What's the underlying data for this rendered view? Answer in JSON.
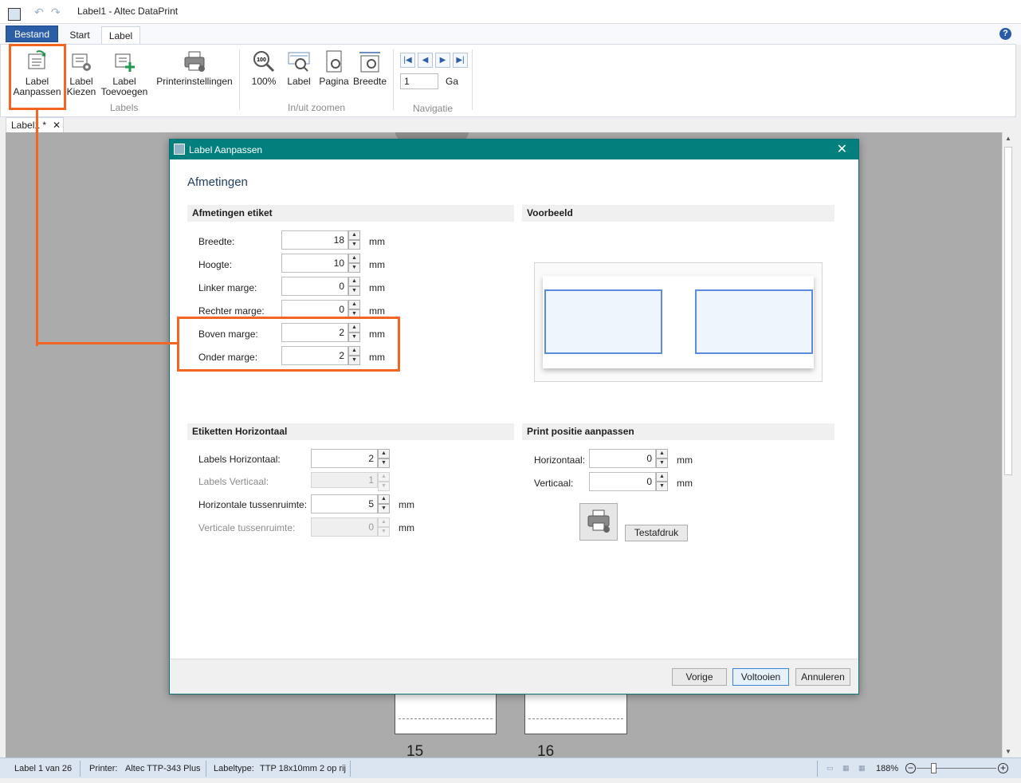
{
  "window": {
    "title": "Label1 - Altec DataPrint"
  },
  "ribbon_tabs": {
    "file": "Bestand",
    "start": "Start",
    "label": "Label"
  },
  "ribbon": {
    "label_aanpassen": "Label\nAanpassen",
    "label_kiezen": "Label\nKiezen",
    "label_toevoegen": "Label\nToevoegen",
    "printerinstellingen": "Printerinstellingen",
    "group_labels": "Labels",
    "zoom_100": "100%",
    "zoom_label": "Label",
    "zoom_pagina": "Pagina",
    "zoom_breedte": "Breedte",
    "group_zoom": "In/uit zoomen",
    "nav_page_value": "1",
    "nav_go": "Ga",
    "group_nav": "Navigatie"
  },
  "doc_tab": {
    "name": "Label1 *"
  },
  "canvas": {
    "label_15": "15",
    "label_16": "16"
  },
  "dialog": {
    "title": "Label Aanpassen",
    "heading": "Afmetingen",
    "section_dimensions": "Afmetingen etiket",
    "section_preview": "Voorbeeld",
    "section_horizontal": "Etiketten Horizontaal",
    "section_print_pos": "Print positie aanpassen",
    "dimensions": [
      {
        "label": "Breedte:",
        "value": "18",
        "unit": "mm"
      },
      {
        "label": "Hoogte:",
        "value": "10",
        "unit": "mm"
      },
      {
        "label": "Linker marge:",
        "value": "0",
        "unit": "mm"
      },
      {
        "label": "Rechter marge:",
        "value": "0",
        "unit": "mm"
      },
      {
        "label": "Boven marge:",
        "value": "2",
        "unit": "mm"
      },
      {
        "label": "Onder marge:",
        "value": "2",
        "unit": "mm"
      }
    ],
    "horizontal": [
      {
        "label": "Labels Horizontaal:",
        "value": "2",
        "unit": "",
        "disabled": false
      },
      {
        "label": "Labels Verticaal:",
        "value": "1",
        "unit": "",
        "disabled": true
      },
      {
        "label": "Horizontale tussenruimte:",
        "value": "5",
        "unit": "mm",
        "disabled": false
      },
      {
        "label": "Verticale tussenruimte:",
        "value": "0",
        "unit": "mm",
        "disabled": true
      }
    ],
    "print_position": [
      {
        "label": "Horizontaal:",
        "value": "0",
        "unit": "mm"
      },
      {
        "label": "Verticaal:",
        "value": "0",
        "unit": "mm"
      }
    ],
    "test_print": "Testafdruk",
    "buttons": {
      "back": "Vorige",
      "finish": "Voltooien",
      "cancel": "Annuleren"
    }
  },
  "status": {
    "label_of": "Label 1 van 26",
    "printer_label": "Printer:",
    "printer_value": "Altec TTP-343 Plus",
    "labeltype_label": "Labeltype:",
    "labeltype_value": "TTP 18x10mm 2 op rij",
    "zoom": "188%"
  },
  "colors": {
    "accent": "#03807e",
    "highlight": "#f26522",
    "file_tab": "#2b5ea6"
  }
}
